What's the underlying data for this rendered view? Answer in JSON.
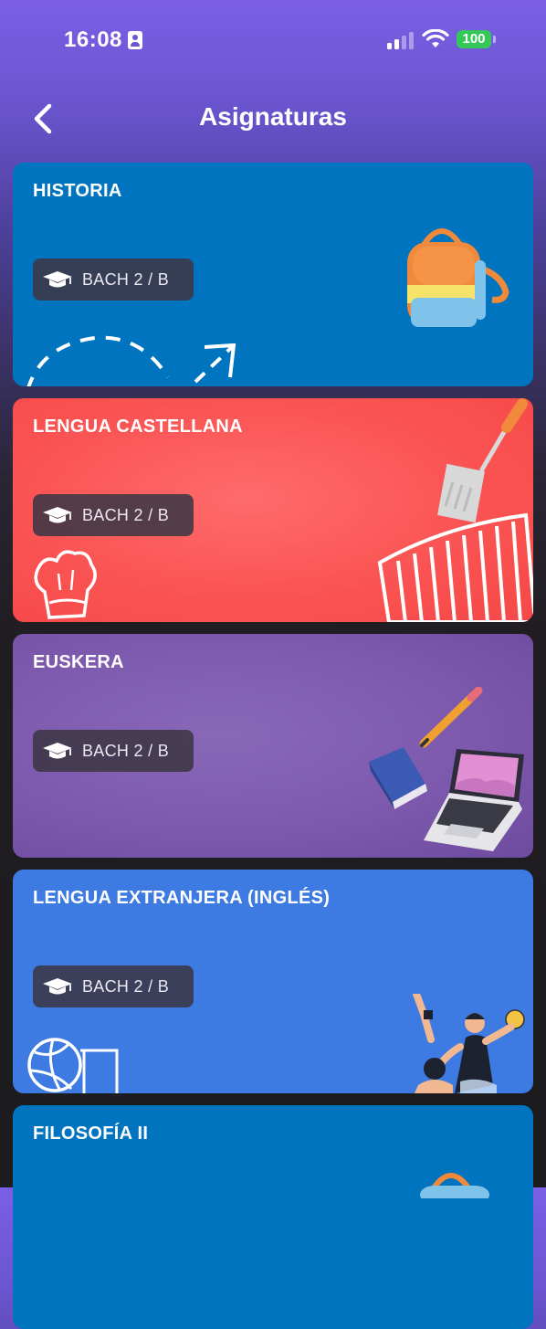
{
  "status": {
    "time": "16:08",
    "battery": "100"
  },
  "nav": {
    "title": "Asignaturas"
  },
  "colors": {
    "historia": "#0074bf",
    "lengua_castellana": "#fa5252",
    "euskera": "#7b58ac",
    "ingles": "#3d7ae1",
    "filosofia": "#0074bf"
  },
  "subjects": [
    {
      "name": "HISTORIA",
      "group": "BACH 2 / B",
      "illustration": "backpack-icon"
    },
    {
      "name": "LENGUA CASTELLANA",
      "group": "BACH 2 / B",
      "illustration": "kitchen-icon"
    },
    {
      "name": "EUSKERA",
      "group": "BACH 2 / B",
      "illustration": "laptop-book-icon"
    },
    {
      "name": "LENGUA EXTRANJERA (INGLÉS)",
      "group": "BACH 2 / B",
      "illustration": "sports-icon"
    },
    {
      "name": "FILOSOFÍA II",
      "group": "",
      "illustration": "backpack-icon"
    }
  ]
}
